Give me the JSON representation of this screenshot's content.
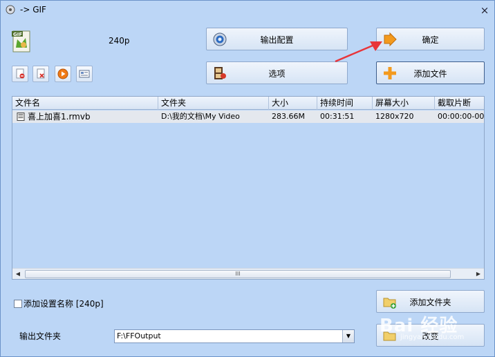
{
  "window": {
    "title": "-> GIF",
    "close_glyph": "×"
  },
  "preset": {
    "label": "240p"
  },
  "buttons": {
    "output_config": "输出配置",
    "ok": "确定",
    "options": "选项",
    "add_file": "添加文件",
    "add_folder": "添加文件夹",
    "change": "改变"
  },
  "filelist": {
    "columns": [
      "文件名",
      "文件夹",
      "大小",
      "持续时间",
      "屏幕大小",
      "截取片断"
    ],
    "rows": [
      {
        "name": "喜上加喜1.rmvb",
        "folder": "D:\\我的文档\\My Video",
        "size": "283.66M",
        "duration": "00:31:51",
        "screen_size": "1280x720",
        "clip": "00:00:00-00:0"
      }
    ],
    "scroll_thumb_glyph": "III"
  },
  "options": {
    "add_setting_name_label": "添加设置名称 [240p]",
    "add_setting_name_checked": false
  },
  "output_folder": {
    "label": "输出文件夹",
    "value": "F:\\FFOutput"
  },
  "watermark": {
    "text": "Bai 经验",
    "sub": "jingyan.baidu.com"
  },
  "colors": {
    "window_bg": "#bcd6f6",
    "annotation_arrow": "#e8353a",
    "add_icon": "#f39a1e"
  }
}
